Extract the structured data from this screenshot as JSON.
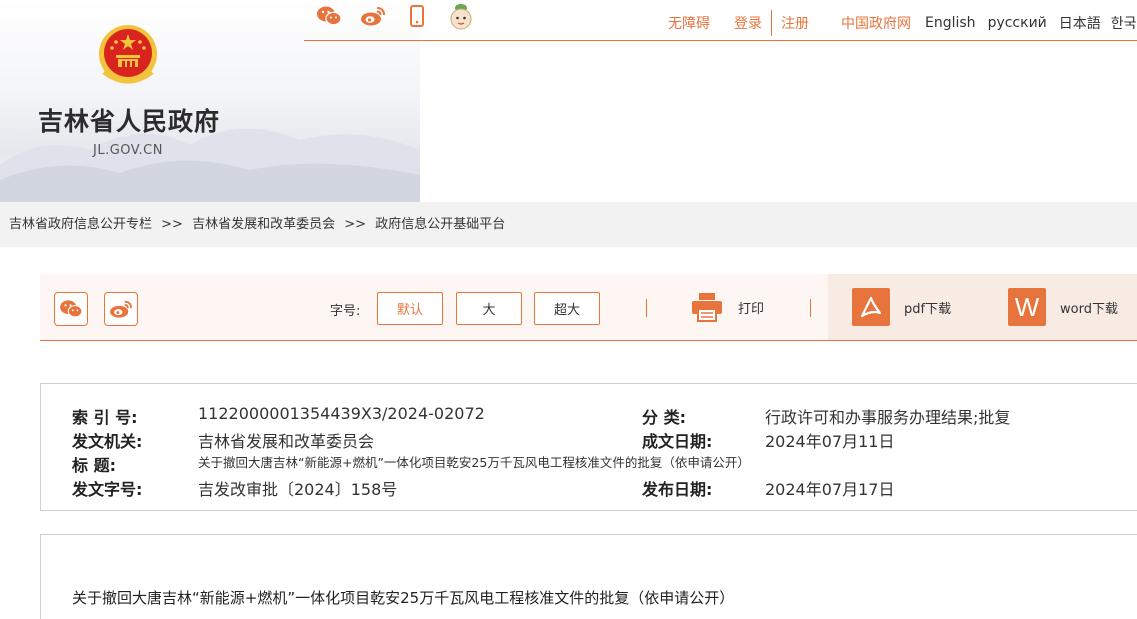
{
  "site": {
    "title": "吉林省人民政府",
    "domain": "JL.GOV.CN"
  },
  "topbar": {
    "share_icons": [
      "wechat-icon",
      "weibo-icon",
      "mobile-icon",
      "mascot-icon"
    ],
    "links": {
      "accessibility": "无障碍",
      "login": "登录",
      "register": "注册",
      "gov_portal": "中国政府网",
      "english": "English",
      "russian": "русский",
      "japanese": "日本語",
      "korean": "한국"
    }
  },
  "breadcrumb": {
    "items": [
      "吉林省政府信息公开专栏",
      "吉林省发展和改革委员会",
      "政府信息公开基础平台"
    ],
    "separator": ">>"
  },
  "toolbar": {
    "fontsize_label": "字号:",
    "fontsize_options": [
      "默认",
      "大",
      "超大"
    ],
    "selected_fontsize": "默认",
    "print_label": "打印",
    "pdf_label": "pdf下载",
    "word_label": "word下载",
    "word_icon_letter": "W"
  },
  "meta": {
    "index_label": "索  引  号:",
    "index_value": "1122000001354439X3/2024-02072",
    "category_label": "分      类:",
    "category_value": "行政许可和办事服务办理结果;批复",
    "issuer_label": "发文机关:",
    "issuer_value": "吉林省发展和改革委员会",
    "created_label": "成文日期:",
    "created_value": "2024年07月11日",
    "title_label": "标      题:",
    "title_value": "关于撤回大唐吉林“新能源+燃机”一体化项目乾安25万千瓦风电工程核准文件的批复（依申请公开）",
    "docno_label": "发文字号:",
    "docno_value": "吉发改审批〔2024〕158号",
    "published_label": "发布日期:",
    "published_value": "2024年07月17日"
  },
  "content": {
    "doc_title": "关于撤回大唐吉林“新能源+燃机”一体化项目乾安25万千瓦风电工程核准文件的批复（依申请公开）"
  },
  "colors": {
    "accent": "#e8743d",
    "emblem_red": "#d8231f",
    "emblem_gold": "#f3c33b"
  }
}
